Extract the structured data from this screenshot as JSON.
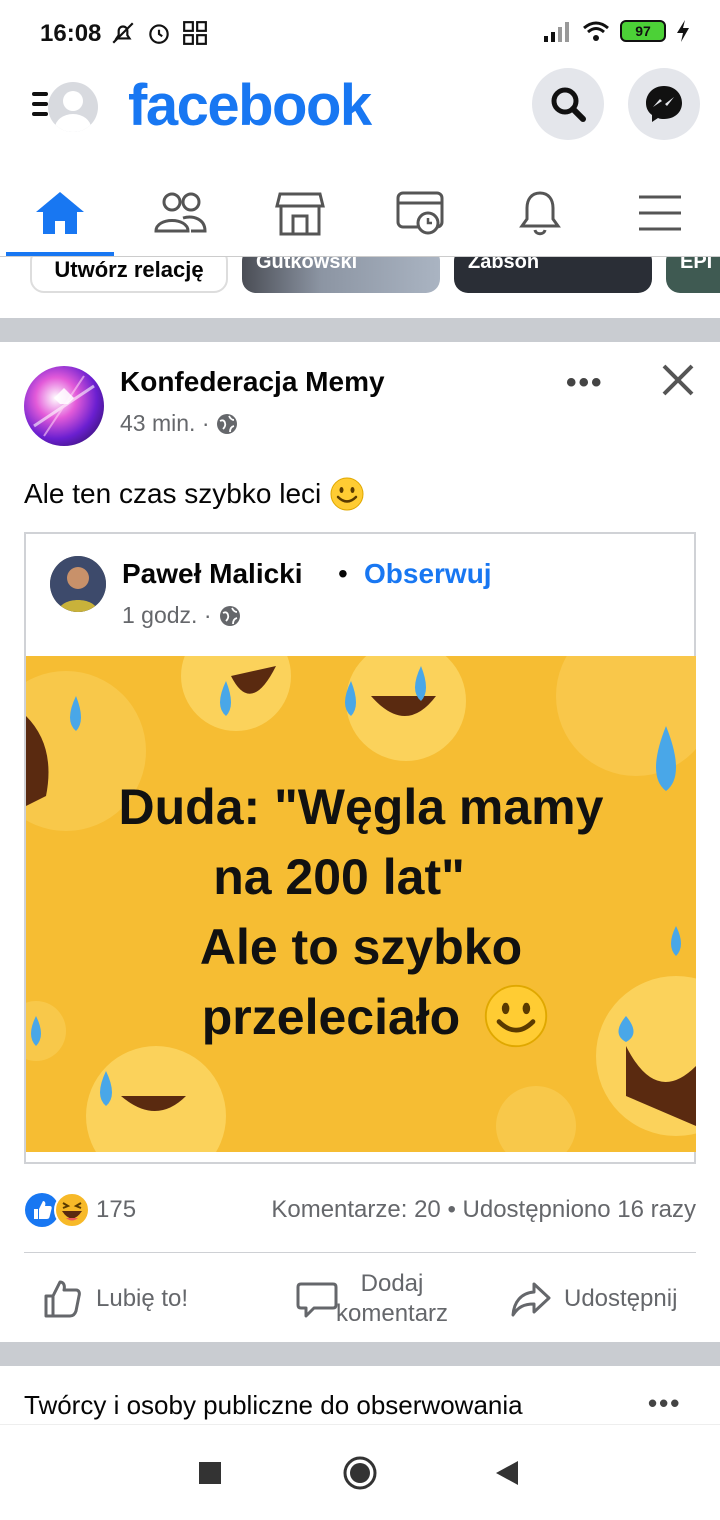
{
  "status_bar": {
    "time": "16:08",
    "battery": "97"
  },
  "header": {
    "logo": "facebook"
  },
  "nav_tabs": [
    {
      "name": "home-icon",
      "active": true
    },
    {
      "name": "friends-icon",
      "active": false
    },
    {
      "name": "marketplace-icon",
      "active": false
    },
    {
      "name": "watch-icon",
      "active": false
    },
    {
      "name": "notifications-icon",
      "active": false
    },
    {
      "name": "menu-icon",
      "active": false
    }
  ],
  "stories": {
    "create_label": "Utwórz relację",
    "items": [
      "Gutkowski",
      "Zabson",
      "EPI"
    ]
  },
  "post": {
    "author": "Konfederacja Memy",
    "time": "43 min. ·",
    "text": "Ale ten czas szybko leci",
    "shared": {
      "author": "Paweł Malicki",
      "separator": "•",
      "follow_label": "Obserwuj",
      "time": "1 godz. ·",
      "meme_lines": [
        "Duda: \"Węgla mamy",
        "na 200 lat\"",
        "Ale to szybko",
        "przeleciało"
      ]
    },
    "reaction_count": "175",
    "stats": "Komentarze: 20 • Udostępniono 16 razy",
    "actions": {
      "like": "Lubię to!",
      "comment_line1": "Dodaj",
      "comment_line2": "komentarz",
      "share": "Udostępnij"
    }
  },
  "suggestions": {
    "title": "Twórcy i osoby publiczne do obserwowania"
  },
  "colors": {
    "brand": "#1877f2",
    "meme_bg": "#f6bd33",
    "divider": "#c9ccd1"
  }
}
